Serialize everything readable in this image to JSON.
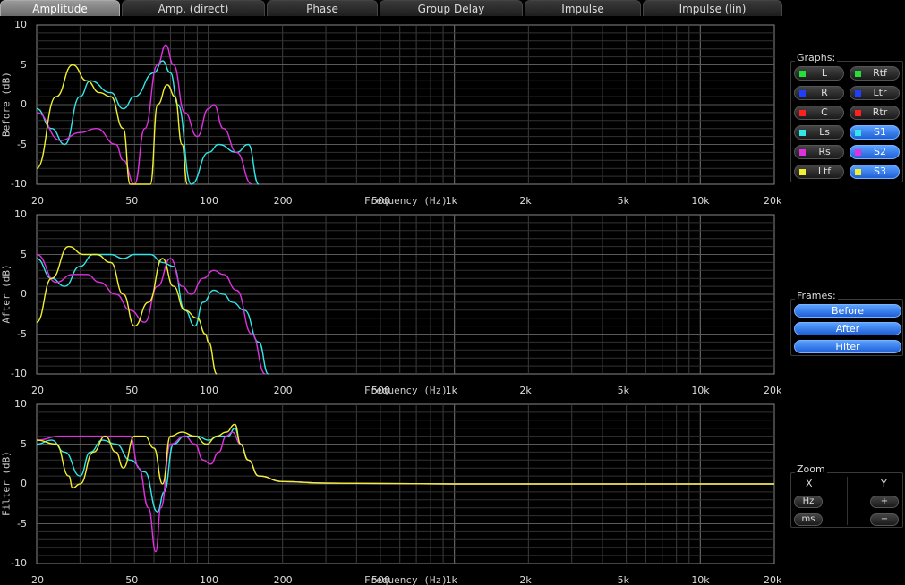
{
  "tabs": [
    {
      "label": "Amplitude",
      "active": true
    },
    {
      "label": "Amp. (direct)",
      "active": false
    },
    {
      "label": "Phase",
      "active": false
    },
    {
      "label": "Group Delay",
      "active": false
    },
    {
      "label": "Impulse",
      "active": false
    },
    {
      "label": "Impulse (lin)",
      "active": false
    }
  ],
  "x_ticks": [
    "20",
    "50",
    "100",
    "200",
    "500",
    "1k",
    "2k",
    "5k",
    "10k",
    "20k"
  ],
  "x_title": "Frequency (Hz)",
  "y_ticks": [
    "10",
    "5",
    "0",
    "-5",
    "-10"
  ],
  "panels": [
    {
      "y_label": "Before (dB)"
    },
    {
      "y_label": "After (dB)"
    },
    {
      "y_label": "Filter (dB)"
    }
  ],
  "graphs": {
    "title": "Graphs:",
    "items": [
      {
        "label": "L",
        "color": "#22e03a",
        "on": false
      },
      {
        "label": "Rtf",
        "color": "#22e03a",
        "on": false
      },
      {
        "label": "R",
        "color": "#1f3fff",
        "on": false
      },
      {
        "label": "Ltr",
        "color": "#1f3fff",
        "on": false
      },
      {
        "label": "C",
        "color": "#ff2020",
        "on": false
      },
      {
        "label": "Rtr",
        "color": "#ff2020",
        "on": false
      },
      {
        "label": "Ls",
        "color": "#30e8e8",
        "on": false
      },
      {
        "label": "S1",
        "color": "#30e8e8",
        "on": true
      },
      {
        "label": "Rs",
        "color": "#e030e0",
        "on": false
      },
      {
        "label": "S2",
        "color": "#e030e0",
        "on": true
      },
      {
        "label": "Ltf",
        "color": "#f0f030",
        "on": false
      },
      {
        "label": "S3",
        "color": "#f0f030",
        "on": true
      }
    ]
  },
  "frames": {
    "title": "Frames:",
    "items": [
      "Before",
      "After",
      "Filter"
    ]
  },
  "zoom": {
    "title": "Zoom",
    "x_label": "X",
    "y_label": "Y",
    "x_buttons": [
      "Hz",
      "ms"
    ],
    "y_buttons": [
      "+",
      "−"
    ]
  },
  "chart_data": [
    {
      "type": "line",
      "ylabel": "Before (dB)",
      "xlabel": "Frequency (Hz)",
      "x_scale": "log",
      "xlim": [
        20,
        20000
      ],
      "ylim": [
        -10,
        10
      ],
      "grid": true,
      "series": [
        {
          "name": "S1",
          "color": "#30e8e8",
          "points": [
            [
              20,
              -0.5
            ],
            [
              23,
              -3
            ],
            [
              26,
              -5
            ],
            [
              30,
              1
            ],
            [
              33,
              3
            ],
            [
              40,
              1.5
            ],
            [
              45,
              -0.5
            ],
            [
              50,
              1
            ],
            [
              60,
              4
            ],
            [
              65,
              5.5
            ],
            [
              70,
              4
            ],
            [
              75,
              0
            ],
            [
              85,
              -10
            ],
            [
              100,
              -6
            ],
            [
              110,
              -5
            ],
            [
              130,
              -6
            ],
            [
              145,
              -5
            ],
            [
              160,
              -10
            ]
          ]
        },
        {
          "name": "S2",
          "color": "#e030e0",
          "points": [
            [
              20,
              -1
            ],
            [
              25,
              -4.5
            ],
            [
              30,
              -3.5
            ],
            [
              35,
              -3
            ],
            [
              42,
              -5
            ],
            [
              45,
              -7
            ],
            [
              50,
              -10
            ],
            [
              55,
              -3
            ],
            [
              62,
              5
            ],
            [
              67,
              7.5
            ],
            [
              72,
              5
            ],
            [
              80,
              -1
            ],
            [
              90,
              -4
            ],
            [
              100,
              -0.5
            ],
            [
              105,
              0
            ],
            [
              115,
              -3
            ],
            [
              130,
              -6
            ],
            [
              150,
              -10
            ]
          ]
        },
        {
          "name": "S3",
          "color": "#f0f030",
          "points": [
            [
              20,
              -8
            ],
            [
              24,
              1
            ],
            [
              28,
              5
            ],
            [
              32,
              3
            ],
            [
              36,
              1.5
            ],
            [
              40,
              1
            ],
            [
              45,
              -3
            ],
            [
              48,
              -10
            ],
            [
              58,
              -10
            ],
            [
              62,
              0
            ],
            [
              68,
              2.5
            ],
            [
              73,
              1
            ],
            [
              78,
              -5
            ],
            [
              82,
              -10
            ]
          ]
        }
      ]
    },
    {
      "type": "line",
      "ylabel": "After (dB)",
      "xlabel": "Frequency (Hz)",
      "x_scale": "log",
      "xlim": [
        20,
        20000
      ],
      "ylim": [
        -10,
        10
      ],
      "grid": true,
      "series": [
        {
          "name": "S1",
          "color": "#30e8e8",
          "points": [
            [
              20,
              4.5
            ],
            [
              23,
              2
            ],
            [
              26,
              1
            ],
            [
              30,
              3.5
            ],
            [
              34,
              5
            ],
            [
              40,
              5
            ],
            [
              45,
              4.5
            ],
            [
              50,
              5
            ],
            [
              58,
              5
            ],
            [
              65,
              4
            ],
            [
              72,
              3.5
            ],
            [
              80,
              -2
            ],
            [
              88,
              -4
            ],
            [
              95,
              -1
            ],
            [
              105,
              0.5
            ],
            [
              115,
              0
            ],
            [
              125,
              -1
            ],
            [
              140,
              -2
            ],
            [
              160,
              -6
            ],
            [
              175,
              -10
            ]
          ]
        },
        {
          "name": "S2",
          "color": "#e030e0",
          "points": [
            [
              20,
              5
            ],
            [
              24,
              1.5
            ],
            [
              28,
              2.5
            ],
            [
              32,
              2.5
            ],
            [
              36,
              1.5
            ],
            [
              42,
              0
            ],
            [
              48,
              -2
            ],
            [
              55,
              -3.5
            ],
            [
              62,
              1
            ],
            [
              70,
              4.5
            ],
            [
              78,
              1
            ],
            [
              85,
              0
            ],
            [
              95,
              2
            ],
            [
              105,
              3
            ],
            [
              115,
              2.5
            ],
            [
              130,
              0.5
            ],
            [
              150,
              -5
            ],
            [
              170,
              -10
            ]
          ]
        },
        {
          "name": "S3",
          "color": "#f0f030",
          "points": [
            [
              20,
              -3.5
            ],
            [
              23,
              2
            ],
            [
              27,
              6
            ],
            [
              31,
              5
            ],
            [
              35,
              5
            ],
            [
              40,
              4
            ],
            [
              45,
              0
            ],
            [
              50,
              -4
            ],
            [
              57,
              -1
            ],
            [
              65,
              4.5
            ],
            [
              72,
              1
            ],
            [
              80,
              -2
            ],
            [
              90,
              -3
            ],
            [
              97,
              -5
            ],
            [
              100,
              -6
            ],
            [
              108,
              -10
            ]
          ]
        }
      ]
    },
    {
      "type": "line",
      "ylabel": "Filter (dB)",
      "xlabel": "Frequency (Hz)",
      "x_scale": "log",
      "xlim": [
        20,
        20000
      ],
      "ylim": [
        -10,
        10
      ],
      "grid": true,
      "series": [
        {
          "name": "S1",
          "color": "#30e8e8",
          "points": [
            [
              20,
              5
            ],
            [
              23,
              5.5
            ],
            [
              26,
              4
            ],
            [
              30,
              1
            ],
            [
              33,
              4
            ],
            [
              37,
              5.5
            ],
            [
              42,
              5
            ],
            [
              48,
              3
            ],
            [
              55,
              1.5
            ],
            [
              62,
              -3.5
            ],
            [
              66,
              -1
            ],
            [
              72,
              5
            ],
            [
              80,
              6
            ],
            [
              90,
              6
            ],
            [
              100,
              5.5
            ],
            [
              110,
              6
            ],
            [
              120,
              6
            ],
            [
              128,
              7
            ],
            [
              135,
              5
            ],
            [
              145,
              3
            ],
            [
              160,
              1
            ],
            [
              200,
              0.3
            ],
            [
              300,
              0.1
            ],
            [
              1000,
              0
            ],
            [
              20000,
              0
            ]
          ]
        },
        {
          "name": "S2",
          "color": "#e030e0",
          "points": [
            [
              20,
              5.5
            ],
            [
              25,
              6
            ],
            [
              30,
              6
            ],
            [
              40,
              6
            ],
            [
              48,
              6
            ],
            [
              52,
              2
            ],
            [
              57,
              -3
            ],
            [
              61,
              -8.5
            ],
            [
              64,
              -3
            ],
            [
              70,
              5
            ],
            [
              80,
              6
            ],
            [
              88,
              5
            ],
            [
              95,
              3
            ],
            [
              102,
              2.5
            ],
            [
              110,
              4
            ],
            [
              118,
              6
            ],
            [
              125,
              6.5
            ],
            [
              135,
              5
            ],
            [
              145,
              3
            ],
            [
              160,
              1
            ],
            [
              200,
              0.3
            ],
            [
              300,
              0.1
            ],
            [
              1000,
              0
            ],
            [
              20000,
              0
            ]
          ]
        },
        {
          "name": "S3",
          "color": "#f0f030",
          "points": [
            [
              20,
              5.5
            ],
            [
              24,
              5
            ],
            [
              27,
              1
            ],
            [
              28,
              -0.5
            ],
            [
              30,
              0
            ],
            [
              34,
              4
            ],
            [
              38,
              6
            ],
            [
              42,
              4
            ],
            [
              45,
              2
            ],
            [
              50,
              6
            ],
            [
              55,
              6
            ],
            [
              60,
              4.5
            ],
            [
              65,
              0
            ],
            [
              70,
              6
            ],
            [
              78,
              6.5
            ],
            [
              88,
              6
            ],
            [
              98,
              5
            ],
            [
              108,
              6
            ],
            [
              118,
              6.5
            ],
            [
              128,
              7.5
            ],
            [
              135,
              5
            ],
            [
              145,
              3
            ],
            [
              160,
              1
            ],
            [
              200,
              0.3
            ],
            [
              300,
              0.1
            ],
            [
              1000,
              0
            ],
            [
              20000,
              0
            ]
          ]
        }
      ]
    }
  ]
}
